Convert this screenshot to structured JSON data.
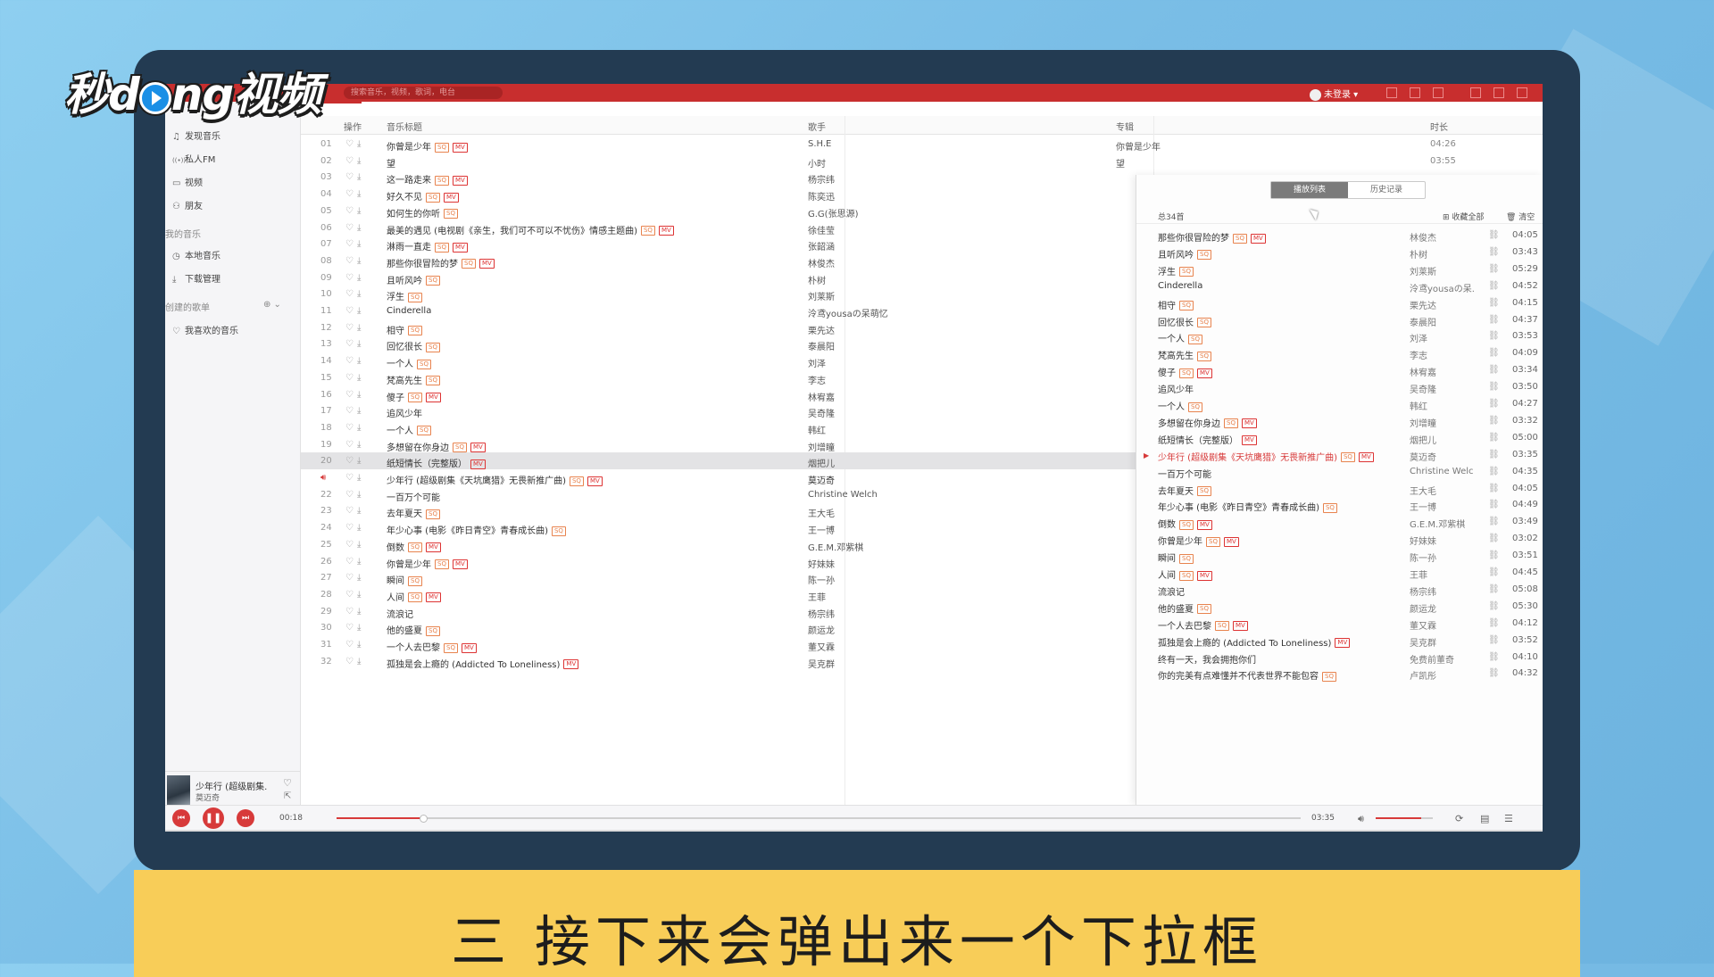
{
  "watermark": {
    "part1": "秒d",
    "part2": "ng视频"
  },
  "caption": "三  接下来会弹出来一个下拉框",
  "app": {
    "search_placeholder": "搜索音乐，视频，歌词，电台",
    "user_name": "未登录",
    "sidebar": {
      "items": [
        {
          "icon": "♫",
          "label": "发现音乐"
        },
        {
          "icon": "((•))",
          "label": "私人FM"
        },
        {
          "icon": "▭",
          "label": "视频"
        },
        {
          "icon": "⚇",
          "label": "朋友"
        }
      ],
      "group_my": "我的音乐",
      "my_items": [
        {
          "icon": "◷",
          "label": "本地音乐"
        },
        {
          "icon": "⤓",
          "label": "下载管理"
        }
      ],
      "group_created": "创建的歌单",
      "created_items": [
        {
          "icon": "♡",
          "label": "我喜欢的音乐"
        }
      ]
    },
    "mini_player": {
      "title": "少年行 (超级剧集...",
      "artist": "莫迈奇"
    },
    "table_headers": {
      "ops": "操作",
      "title": "音乐标题",
      "artist": "歌手",
      "album": "专辑",
      "duration": "时长"
    },
    "songs": [
      {
        "num": "01",
        "title": "你曾是少年",
        "tags": [
          "SQ",
          "MV"
        ],
        "artist": "S.H.E",
        "album": "你曾是少年",
        "dur": "04:26"
      },
      {
        "num": "02",
        "title": "望",
        "tags": [],
        "artist": "小时",
        "album": "望",
        "dur": "03:55"
      },
      {
        "num": "03",
        "title": "这一路走来",
        "tags": [
          "SQ",
          "MV"
        ],
        "artist": "杨宗纬",
        "album": "",
        "dur": ""
      },
      {
        "num": "04",
        "title": "好久不见",
        "tags": [
          "SQ",
          "MV"
        ],
        "artist": "陈奕迅",
        "album": "",
        "dur": ""
      },
      {
        "num": "05",
        "title": "如何生的你听",
        "tags": [
          "SQ"
        ],
        "artist": "G.G(张思源)",
        "album": "",
        "dur": ""
      },
      {
        "num": "06",
        "title": "最美的遇见 (电视剧《亲生，我们可不可以不忧伤》情感主题曲)",
        "tags": [
          "SQ",
          "MV"
        ],
        "artist": "徐佳莹",
        "album": "",
        "dur": ""
      },
      {
        "num": "07",
        "title": "淋雨一直走",
        "tags": [
          "SQ",
          "MV"
        ],
        "artist": "张韶涵",
        "album": "",
        "dur": ""
      },
      {
        "num": "08",
        "title": "那些你很冒险的梦",
        "tags": [
          "SQ",
          "MV"
        ],
        "artist": "林俊杰",
        "album": "",
        "dur": ""
      },
      {
        "num": "09",
        "title": "且听风吟",
        "tags": [
          "SQ"
        ],
        "artist": "朴树",
        "album": "",
        "dur": ""
      },
      {
        "num": "10",
        "title": "浮生",
        "tags": [
          "SQ"
        ],
        "artist": "刘莱斯",
        "album": "",
        "dur": ""
      },
      {
        "num": "11",
        "title": "Cinderella",
        "tags": [],
        "artist": "泠鸢yousaの呆萌忆",
        "album": "",
        "dur": ""
      },
      {
        "num": "12",
        "title": "相守",
        "tags": [
          "SQ"
        ],
        "artist": "栗先达",
        "album": "",
        "dur": ""
      },
      {
        "num": "13",
        "title": "回忆很长",
        "tags": [
          "SQ"
        ],
        "artist": "泰晨阳",
        "album": "",
        "dur": ""
      },
      {
        "num": "14",
        "title": "一个人",
        "tags": [
          "SQ"
        ],
        "artist": "刘泽",
        "album": "",
        "dur": ""
      },
      {
        "num": "15",
        "title": "梵高先生",
        "tags": [
          "SQ"
        ],
        "artist": "李志",
        "album": "",
        "dur": ""
      },
      {
        "num": "16",
        "title": "傻子",
        "tags": [
          "SQ",
          "MV"
        ],
        "artist": "林宥嘉",
        "album": "",
        "dur": ""
      },
      {
        "num": "17",
        "title": "追风少年",
        "tags": [],
        "artist": "吴奇隆",
        "album": "",
        "dur": ""
      },
      {
        "num": "18",
        "title": "一个人",
        "tags": [
          "SQ"
        ],
        "artist": "韩红",
        "album": "",
        "dur": ""
      },
      {
        "num": "19",
        "title": "多想留在你身边",
        "tags": [
          "SQ",
          "MV"
        ],
        "artist": "刘增瞳",
        "album": "",
        "dur": ""
      },
      {
        "num": "20",
        "title": "纸短情长（完整版）",
        "tags": [
          "MV"
        ],
        "artist": "烟把儿",
        "album": "",
        "dur": ""
      },
      {
        "num": "21",
        "title": "少年行 (超级剧集《天坑鹰猎》无畏新推广曲)",
        "tags": [
          "SQ",
          "MV"
        ],
        "artist": "莫迈奇",
        "album": "",
        "dur": ""
      },
      {
        "num": "22",
        "title": "一百万个可能",
        "tags": [],
        "artist": "Christine Welch",
        "album": "",
        "dur": ""
      },
      {
        "num": "23",
        "title": "去年夏天",
        "tags": [
          "SQ"
        ],
        "artist": "王大毛",
        "album": "",
        "dur": ""
      },
      {
        "num": "24",
        "title": "年少心事 (电影《昨日青空》青春成长曲)",
        "tags": [
          "SQ"
        ],
        "artist": "王一博",
        "album": "",
        "dur": ""
      },
      {
        "num": "25",
        "title": "倒数",
        "tags": [
          "SQ",
          "MV"
        ],
        "artist": "G.E.M.邓紫棋",
        "album": "",
        "dur": ""
      },
      {
        "num": "26",
        "title": "你曾是少年",
        "tags": [
          "SQ",
          "MV"
        ],
        "artist": "好妹妹",
        "album": "",
        "dur": ""
      },
      {
        "num": "27",
        "title": "瞬间",
        "tags": [
          "SQ"
        ],
        "artist": "陈一孙",
        "album": "",
        "dur": ""
      },
      {
        "num": "28",
        "title": "人间",
        "tags": [
          "SQ",
          "MV"
        ],
        "artist": "王菲",
        "album": "",
        "dur": ""
      },
      {
        "num": "29",
        "title": "流浪记",
        "tags": [],
        "artist": "杨宗纬",
        "album": "",
        "dur": ""
      },
      {
        "num": "30",
        "title": "他的盛夏",
        "tags": [
          "SQ"
        ],
        "artist": "颜运龙",
        "album": "",
        "dur": ""
      },
      {
        "num": "31",
        "title": "一个人去巴黎",
        "tags": [
          "SQ",
          "MV"
        ],
        "artist": "董又霖",
        "album": "",
        "dur": ""
      },
      {
        "num": "32",
        "title": "孤独是会上瘾的 (Addicted To Loneliness)",
        "tags": [
          "MV"
        ],
        "artist": "吴克群",
        "album": "",
        "dur": ""
      }
    ],
    "popup": {
      "tab_playlist": "播放列表",
      "tab_history": "历史记录",
      "count": "总34首",
      "collect_all": "收藏全部",
      "clear": "清空",
      "rows": [
        {
          "title": "那些你很冒险的梦",
          "tags": [
            "SQ",
            "MV"
          ],
          "artist": "林俊杰",
          "dur": "04:05"
        },
        {
          "title": "且听风吟",
          "tags": [
            "SQ"
          ],
          "artist": "朴树",
          "dur": "03:43"
        },
        {
          "title": "浮生",
          "tags": [
            "SQ"
          ],
          "artist": "刘莱斯",
          "dur": "05:29"
        },
        {
          "title": "Cinderella",
          "tags": [],
          "artist": "泠鸢yousaの呆...",
          "dur": "04:52"
        },
        {
          "title": "相守",
          "tags": [
            "SQ"
          ],
          "artist": "栗先达",
          "dur": "04:15"
        },
        {
          "title": "回忆很长",
          "tags": [
            "SQ"
          ],
          "artist": "泰晨阳",
          "dur": "04:37"
        },
        {
          "title": "一个人",
          "tags": [
            "SQ"
          ],
          "artist": "刘泽",
          "dur": "03:53"
        },
        {
          "title": "梵高先生",
          "tags": [
            "SQ"
          ],
          "artist": "李志",
          "dur": "04:09"
        },
        {
          "title": "傻子",
          "tags": [
            "SQ",
            "MV"
          ],
          "artist": "林宥嘉",
          "dur": "03:34"
        },
        {
          "title": "追风少年",
          "tags": [],
          "artist": "吴奇隆",
          "dur": "03:50"
        },
        {
          "title": "一个人",
          "tags": [
            "SQ"
          ],
          "artist": "韩红",
          "dur": "04:27"
        },
        {
          "title": "多想留在你身边",
          "tags": [
            "SQ",
            "MV"
          ],
          "artist": "刘增瞳",
          "dur": "03:32"
        },
        {
          "title": "纸短情长（完整版）",
          "tags": [
            "MV"
          ],
          "artist": "烟把儿",
          "dur": "05:00"
        },
        {
          "title": "少年行 (超级剧集《天坑鹰猎》无畏新推广曲)",
          "tags": [
            "SQ",
            "MV"
          ],
          "artist": "莫迈奇",
          "dur": "03:35",
          "playing": true
        },
        {
          "title": "一百万个可能",
          "tags": [],
          "artist": "Christine Welch",
          "dur": "04:35"
        },
        {
          "title": "去年夏天",
          "tags": [
            "SQ"
          ],
          "artist": "王大毛",
          "dur": "04:05"
        },
        {
          "title": "年少心事 (电影《昨日青空》青春成长曲)",
          "tags": [
            "SQ"
          ],
          "artist": "王一博",
          "dur": "04:49"
        },
        {
          "title": "倒数",
          "tags": [
            "SQ",
            "MV"
          ],
          "artist": "G.E.M.邓紫棋",
          "dur": "03:49"
        },
        {
          "title": "你曾是少年",
          "tags": [
            "SQ",
            "MV"
          ],
          "artist": "好妹妹",
          "dur": "03:02"
        },
        {
          "title": "瞬间",
          "tags": [
            "SQ"
          ],
          "artist": "陈一孙",
          "dur": "03:51"
        },
        {
          "title": "人间",
          "tags": [
            "SQ",
            "MV"
          ],
          "artist": "王菲",
          "dur": "04:45"
        },
        {
          "title": "流浪记",
          "tags": [],
          "artist": "杨宗纬",
          "dur": "05:08"
        },
        {
          "title": "他的盛夏",
          "tags": [
            "SQ"
          ],
          "artist": "颜运龙",
          "dur": "05:30"
        },
        {
          "title": "一个人去巴黎",
          "tags": [
            "SQ",
            "MV"
          ],
          "artist": "董又霖",
          "dur": "04:12"
        },
        {
          "title": "孤独是会上瘾的 (Addicted To Loneliness)",
          "tags": [
            "MV"
          ],
          "artist": "吴克群",
          "dur": "03:52"
        },
        {
          "title": "终有一天，我会拥抱你们",
          "tags": [],
          "artist": "免费前董奇",
          "dur": "04:10"
        },
        {
          "title": "你的完美有点难懂并不代表世界不能包容",
          "tags": [
            "SQ"
          ],
          "artist": "卢凯彤",
          "dur": "04:32"
        }
      ]
    },
    "player": {
      "current": "00:18",
      "total": "03:35",
      "progress": 0.09,
      "volume": 0.8
    },
    "colors": {
      "accent": "#d73a3a",
      "topbar": "#c82e2e",
      "caption_bg": "#f8cd58",
      "monitor": "#233b52"
    }
  }
}
